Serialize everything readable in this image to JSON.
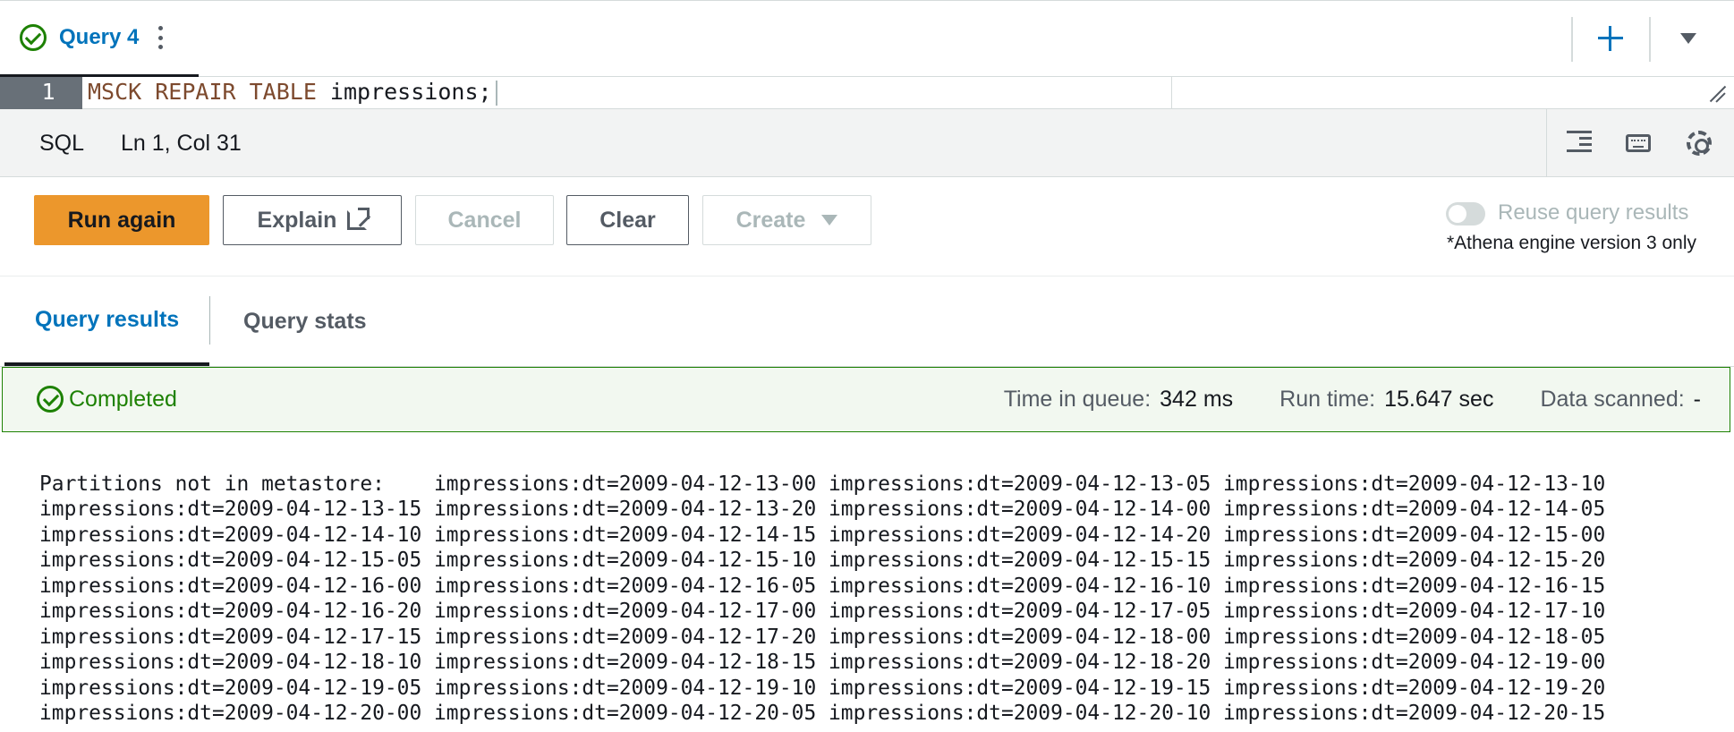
{
  "tab": {
    "label": "Query 4"
  },
  "editor": {
    "line_number": "1",
    "keywords": "MSCK REPAIR TABLE",
    "rest": " impressions;"
  },
  "status": {
    "language": "SQL",
    "position": "Ln 1, Col 31"
  },
  "actions": {
    "run_again": "Run again",
    "explain": "Explain",
    "cancel": "Cancel",
    "clear": "Clear",
    "create": "Create",
    "reuse_label": "Reuse query results",
    "reuse_enabled": false,
    "reuse_note": "*Athena engine version 3 only"
  },
  "results_tabs": {
    "results": "Query results",
    "stats": "Query stats"
  },
  "banner": {
    "status": "Completed",
    "queue_label": "Time in queue:",
    "queue_value": "342 ms",
    "run_label": "Run time:",
    "run_value": "15.647 sec",
    "scanned_label": "Data scanned:",
    "scanned_value": "-"
  },
  "output_lines": [
    "Partitions not in metastore:    impressions:dt=2009-04-12-13-00 impressions:dt=2009-04-12-13-05 impressions:dt=2009-04-12-13-10",
    "impressions:dt=2009-04-12-13-15 impressions:dt=2009-04-12-13-20 impressions:dt=2009-04-12-14-00 impressions:dt=2009-04-12-14-05",
    "impressions:dt=2009-04-12-14-10 impressions:dt=2009-04-12-14-15 impressions:dt=2009-04-12-14-20 impressions:dt=2009-04-12-15-00",
    "impressions:dt=2009-04-12-15-05 impressions:dt=2009-04-12-15-10 impressions:dt=2009-04-12-15-15 impressions:dt=2009-04-12-15-20",
    "impressions:dt=2009-04-12-16-00 impressions:dt=2009-04-12-16-05 impressions:dt=2009-04-12-16-10 impressions:dt=2009-04-12-16-15",
    "impressions:dt=2009-04-12-16-20 impressions:dt=2009-04-12-17-00 impressions:dt=2009-04-12-17-05 impressions:dt=2009-04-12-17-10",
    "impressions:dt=2009-04-12-17-15 impressions:dt=2009-04-12-17-20 impressions:dt=2009-04-12-18-00 impressions:dt=2009-04-12-18-05",
    "impressions:dt=2009-04-12-18-10 impressions:dt=2009-04-12-18-15 impressions:dt=2009-04-12-18-20 impressions:dt=2009-04-12-19-00",
    "impressions:dt=2009-04-12-19-05 impressions:dt=2009-04-12-19-10 impressions:dt=2009-04-12-19-15 impressions:dt=2009-04-12-19-20",
    "impressions:dt=2009-04-12-20-00 impressions:dt=2009-04-12-20-05 impressions:dt=2009-04-12-20-10 impressions:dt=2009-04-12-20-15"
  ]
}
